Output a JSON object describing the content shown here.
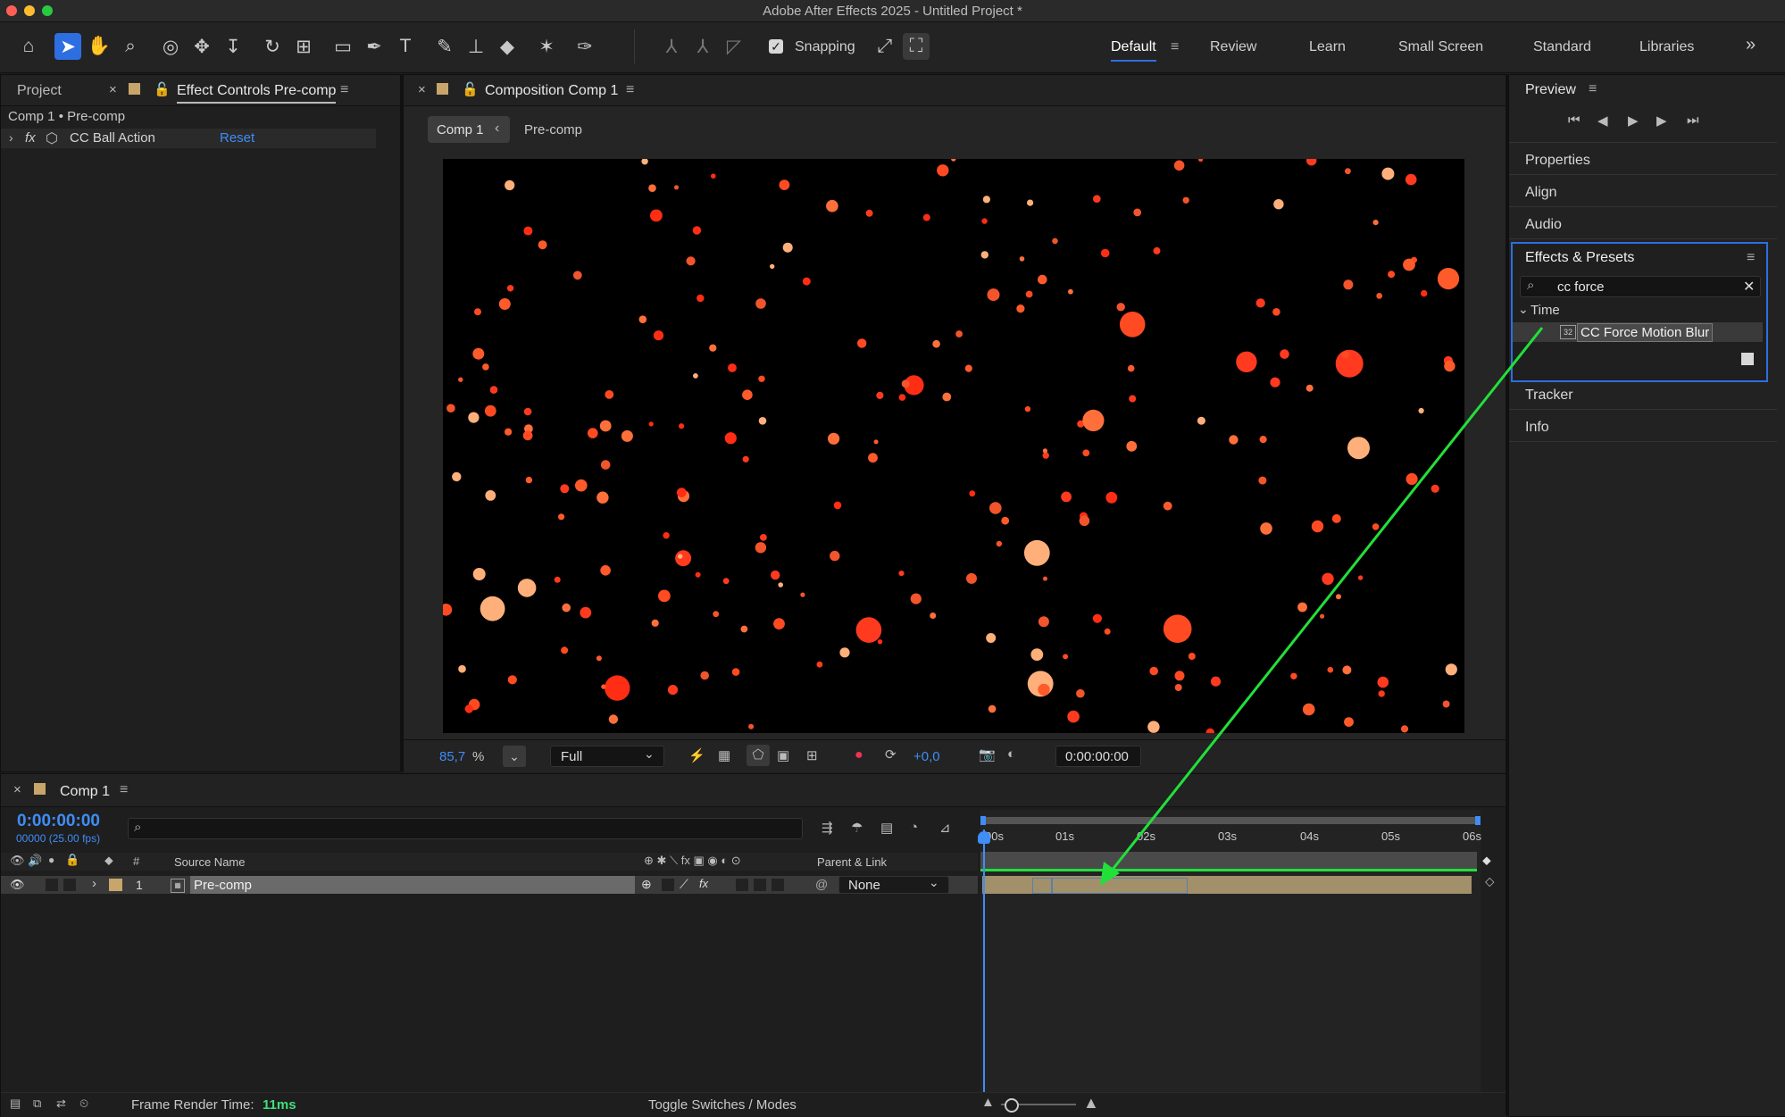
{
  "window": {
    "title": "Adobe After Effects 2025 - Untitled Project *"
  },
  "toolbar": {
    "snapping_label": "Snapping",
    "workspaces": [
      "Default",
      "Review",
      "Learn",
      "Small Screen",
      "Standard",
      "Libraries"
    ],
    "more": "»"
  },
  "left_panel": {
    "tab_project": "Project",
    "tab_effect_controls": "Effect Controls Pre-comp",
    "breadcrumb": "Comp 1 • Pre-comp",
    "effect_name": "CC Ball Action",
    "reset_label": "Reset",
    "fx_label": "fx"
  },
  "composition": {
    "tab_title": "Composition Comp 1",
    "crumb_comp": "Comp 1",
    "crumb_pre": "Pre-comp",
    "zoom": "85,7",
    "zoom_unit": "%",
    "resolution": "Full",
    "exposure": "+0,0",
    "timecode": "0:00:00:00"
  },
  "right_panel": {
    "preview_title": "Preview",
    "properties": "Properties",
    "align": "Align",
    "audio": "Audio",
    "effects_title": "Effects & Presets",
    "search_value": "cc force",
    "category": "Time",
    "effect_item": "CC Force Motion Blur",
    "tracker": "Tracker",
    "info": "Info"
  },
  "timeline": {
    "tab_title": "Comp 1",
    "current_time": "0:00:00:00",
    "frame_info": "00000 (25.00 fps)",
    "col_hash": "#",
    "col_source": "Source Name",
    "col_parent": "Parent & Link",
    "layer_number": "1",
    "layer_name": "Pre-comp",
    "parent_value": "None",
    "ruler": [
      "00s",
      "01s",
      "02s",
      "03s",
      "04s",
      "05s",
      "06s"
    ],
    "frame_render_label": "Frame Render Time:",
    "frame_render_value": "11ms",
    "toggle_label": "Toggle Switches / Modes"
  },
  "colors": {
    "accent": "#2d6fe0",
    "particle": "#ff3a1f",
    "arrow": "#22e03a",
    "layer_bar": "#a2906b"
  }
}
